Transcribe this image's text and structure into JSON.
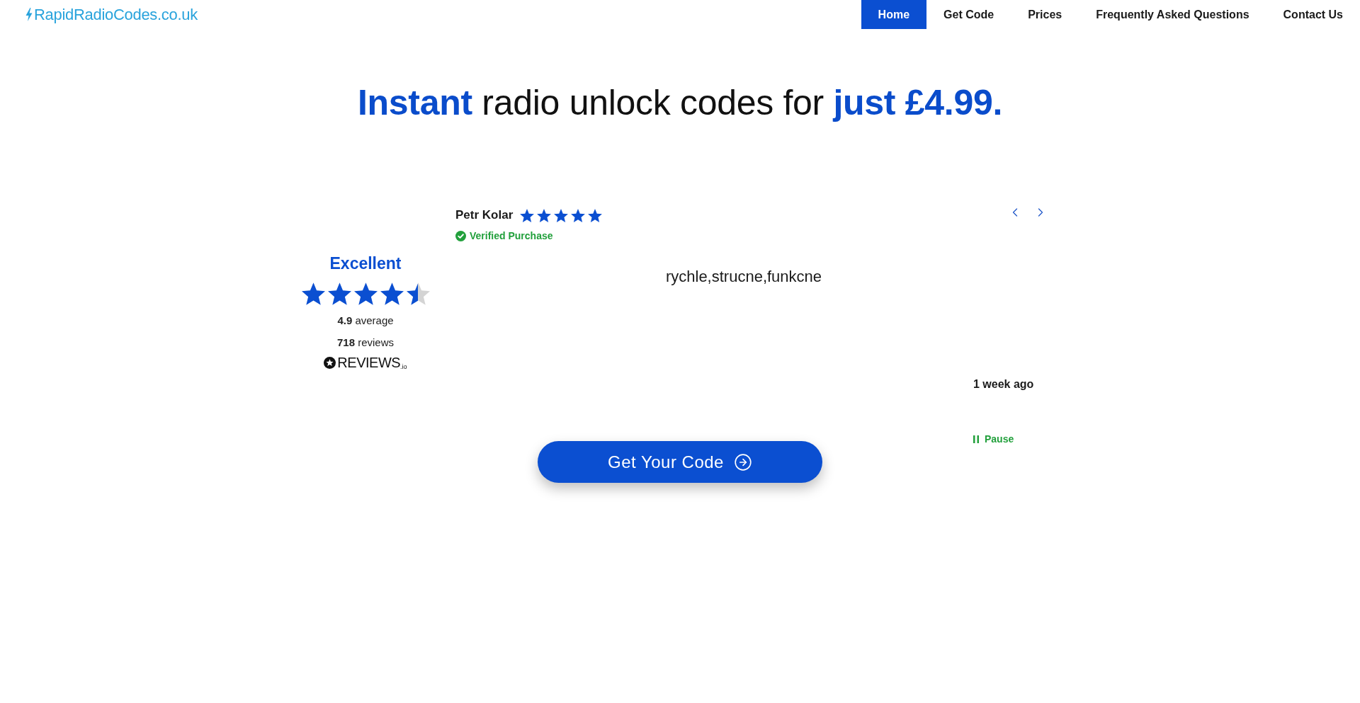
{
  "header": {
    "logo": "RapidRadioCodes.co.uk",
    "nav": [
      {
        "label": "Home",
        "selected": true
      },
      {
        "label": "Get Code",
        "selected": false
      },
      {
        "label": "Prices",
        "selected": false
      },
      {
        "label": "Frequently Asked Questions",
        "selected": false
      },
      {
        "label": "Contact Us",
        "selected": false
      }
    ]
  },
  "hero": {
    "headline": "**Instant** radio unlock codes for **just £4.99.**"
  },
  "reviews_widget": {
    "summary": {
      "rating_label": "Excellent",
      "stars": 4.5,
      "average": "**4.9** average",
      "count": "**718** reviews",
      "brand": "REVIEWS$_{.io}$"
    },
    "review": {
      "author": "Petr Kolar",
      "stars": 5,
      "verified": true,
      "verified_label": "Verified Purchase",
      "text": "rychle,strucne,funkcne",
      "time": "1 week ago"
    },
    "carousel": {
      "pause_label": "Pause"
    }
  },
  "cta": {
    "label": "Get Your Code"
  }
}
